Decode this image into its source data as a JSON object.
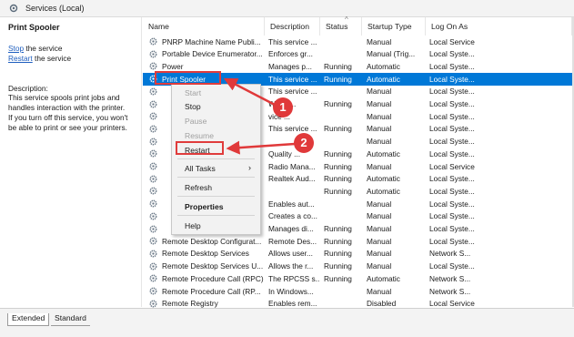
{
  "window": {
    "title": "Services (Local)"
  },
  "left": {
    "heading": "Print Spooler",
    "stop_link": "Stop",
    "stop_suffix": " the service",
    "restart_link": "Restart",
    "restart_suffix": " the service",
    "desc_label": "Description:",
    "desc_lines": [
      "This service spools print jobs and",
      "handles interaction with the printer.",
      "If you turn off this service, you won't",
      "be able to print or see your printers."
    ]
  },
  "columns": [
    "Name",
    "Description",
    "Status",
    "Startup Type",
    "Log On As"
  ],
  "rows": [
    {
      "name": "PNRP Machine Name Publi...",
      "desc": "This service ...",
      "status": "",
      "startup": "Manual",
      "logon": "Local Service"
    },
    {
      "name": "Portable Device Enumerator...",
      "desc": "Enforces gr...",
      "status": "",
      "startup": "Manual (Trig...",
      "logon": "Local Syste..."
    },
    {
      "name": "Power",
      "desc": "Manages p...",
      "status": "Running",
      "startup": "Automatic",
      "logon": "Local Syste..."
    },
    {
      "name": "Print Spooler",
      "desc": "This service ...",
      "status": "Running",
      "startup": "Automatic",
      "logon": "Local Syste..."
    },
    {
      "name": "",
      "desc": "This service ...",
      "status": "",
      "startup": "Manual",
      "logon": "Local Syste..."
    },
    {
      "name": "",
      "desc": "Workfl...",
      "status": "Running",
      "startup": "Manual",
      "logon": "Local Syste..."
    },
    {
      "name": "",
      "desc": "vice ...",
      "status": "",
      "startup": "Manual",
      "logon": "Local Syste..."
    },
    {
      "name": "",
      "desc": "This service ...",
      "status": "Running",
      "startup": "Manual",
      "logon": "Local Syste..."
    },
    {
      "name": "",
      "desc": "",
      "status": "",
      "startup": "Manual",
      "logon": "Local Syste..."
    },
    {
      "name": "",
      "desc": "Quality ...",
      "status": "Running",
      "startup": "Automatic",
      "logon": "Local Syste..."
    },
    {
      "name": "",
      "desc": "Radio Mana...",
      "status": "Running",
      "startup": "Manual",
      "logon": "Local Service"
    },
    {
      "name": "",
      "desc": "Realtek Aud...",
      "status": "Running",
      "startup": "Automatic",
      "logon": "Local Syste..."
    },
    {
      "name": "",
      "desc": "",
      "status": "Running",
      "startup": "Automatic",
      "logon": "Local Syste..."
    },
    {
      "name": "",
      "desc": "Enables aut...",
      "status": "",
      "startup": "Manual",
      "logon": "Local Syste..."
    },
    {
      "name": "",
      "desc": "Creates a co...",
      "status": "",
      "startup": "Manual",
      "logon": "Local Syste..."
    },
    {
      "name": "",
      "desc": "Manages di...",
      "status": "Running",
      "startup": "Manual",
      "logon": "Local Syste..."
    },
    {
      "name": "Remote Desktop Configurat...",
      "desc": "Remote Des...",
      "status": "Running",
      "startup": "Manual",
      "logon": "Local Syste..."
    },
    {
      "name": "Remote Desktop Services",
      "desc": "Allows user...",
      "status": "Running",
      "startup": "Manual",
      "logon": "Network S..."
    },
    {
      "name": "Remote Desktop Services U...",
      "desc": "Allows the r...",
      "status": "Running",
      "startup": "Manual",
      "logon": "Local Syste..."
    },
    {
      "name": "Remote Procedure Call (RPC)",
      "desc": "The RPCSS s...",
      "status": "Running",
      "startup": "Automatic",
      "logon": "Network S..."
    },
    {
      "name": "Remote Procedure Call (RP...",
      "desc": "In Windows...",
      "status": "",
      "startup": "Manual",
      "logon": "Network S..."
    },
    {
      "name": "Remote Registry",
      "desc": "Enables rem...",
      "status": "",
      "startup": "Disabled",
      "logon": "Local Service"
    }
  ],
  "menu": {
    "start": "Start",
    "stop": "Stop",
    "pause": "Pause",
    "resume": "Resume",
    "restart": "Restart",
    "all_tasks": "All Tasks",
    "refresh": "Refresh",
    "properties": "Properties",
    "help": "Help"
  },
  "callouts": {
    "one": "1",
    "two": "2"
  },
  "tabs": {
    "extended": "Extended",
    "standard": "Standard"
  },
  "colors": {
    "selection": "#0078d7",
    "callout": "#e0393a"
  }
}
